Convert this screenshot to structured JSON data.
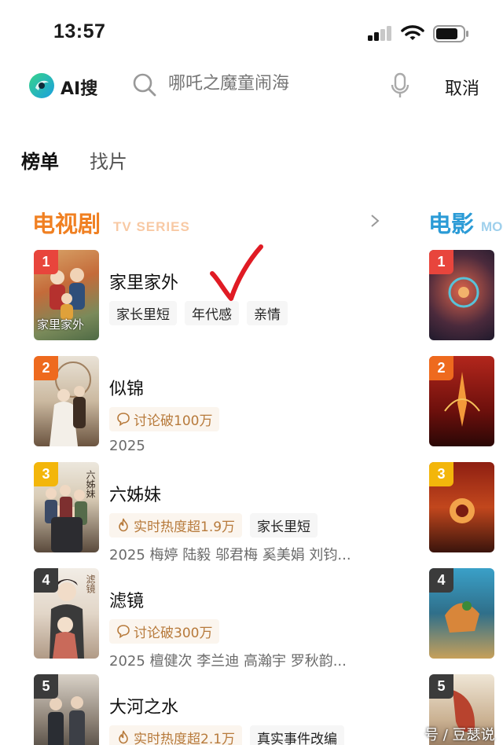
{
  "status_bar": {
    "time": "13:57"
  },
  "header": {
    "ai_label": "AI搜",
    "search_placeholder": "哪吒之魔童闹海",
    "cancel_label": "取消"
  },
  "tabs": [
    {
      "label": "榜单",
      "active": true
    },
    {
      "label": "找片",
      "active": false
    }
  ],
  "tv_section": {
    "title": "电视剧",
    "subtitle": "TV SERIES",
    "items": [
      {
        "rank": "1",
        "title": "家里家外",
        "tags": [
          "家长里短",
          "年代感",
          "亲情"
        ],
        "meta": "",
        "poster_text": "家里家外"
      },
      {
        "rank": "2",
        "title": "似锦",
        "hot": "讨论破100万",
        "hot_icon": "comment-icon",
        "tags": [],
        "meta": "2025"
      },
      {
        "rank": "3",
        "title": "六姊妹",
        "hot": "实时热度超1.9万",
        "hot_icon": "flame-icon",
        "tags": [
          "家长里短"
        ],
        "meta": "2025 梅婷 陆毅 邬君梅 奚美娟 刘钧...",
        "poster_text": "六姊妹"
      },
      {
        "rank": "4",
        "title": "滤镜",
        "hot": "讨论破300万",
        "hot_icon": "comment-icon",
        "tags": [],
        "meta": "2025 檀健次 李兰迪 高瀚宇 罗秋韵...",
        "poster_text": "滤镜"
      },
      {
        "rank": "5",
        "title": "大河之水",
        "hot": "实时热度超2.1万",
        "hot_icon": "flame-icon",
        "tags": [
          "真实事件改编"
        ],
        "meta": ""
      }
    ]
  },
  "movie_section": {
    "title": "电影",
    "subtitle": "MO",
    "items": [
      {
        "rank": "1"
      },
      {
        "rank": "2"
      },
      {
        "rank": "3"
      },
      {
        "rank": "4"
      },
      {
        "rank": "5"
      }
    ]
  },
  "colors": {
    "tv_accent": "#f08022",
    "movie_accent": "#2b9bd6",
    "check_mark": "#e01b24"
  },
  "watermark": "号 / 豆瑟说"
}
